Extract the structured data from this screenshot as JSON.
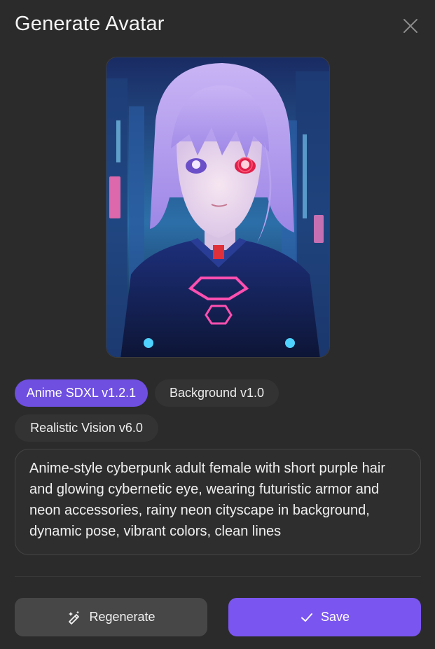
{
  "dialog": {
    "title": "Generate Avatar",
    "close_icon": "close-icon"
  },
  "preview": {
    "description_icon": "avatar-image"
  },
  "models": [
    {
      "label": "Anime SDXL v1.2.1",
      "selected": true
    },
    {
      "label": "Background v1.0",
      "selected": false
    },
    {
      "label": "Realistic Vision v6.0",
      "selected": false
    }
  ],
  "prompt": {
    "text": "Anime-style cyberpunk adult female with short purple hair and glowing cybernetic eye, wearing futuristic armor and neon accessories, rainy neon cityscape in background, dynamic pose, vibrant colors, clean lines"
  },
  "actions": {
    "regenerate_label": "Regenerate",
    "regenerate_icon": "magic-wand-icon",
    "save_label": "Save",
    "save_icon": "check-icon"
  },
  "colors": {
    "background": "#2b2b2b",
    "accent": "#7b55f0",
    "chip_active": "#6e4fe0",
    "chip": "#333333",
    "secondary_button": "#474747"
  }
}
